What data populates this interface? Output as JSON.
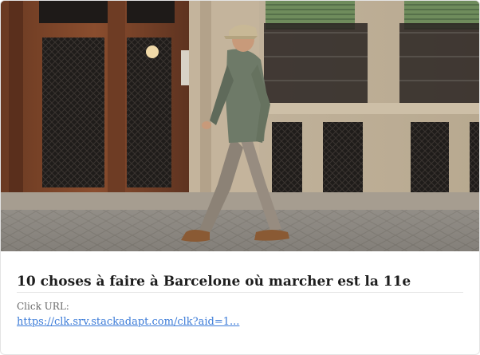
{
  "card": {
    "title": "10 choses à faire à Barcelone où marcher est la 11e",
    "click_url_label": "Click URL:",
    "click_url": "https://clk.srv.stackadapt.com/clk?aid=1..."
  },
  "image": {
    "subject": "man-walking-barcelona-street-photo"
  },
  "colors": {
    "title": "#1d1d1d",
    "label": "#6a6a6a",
    "link": "#3b7bd8",
    "border": "#e4e4e4"
  }
}
